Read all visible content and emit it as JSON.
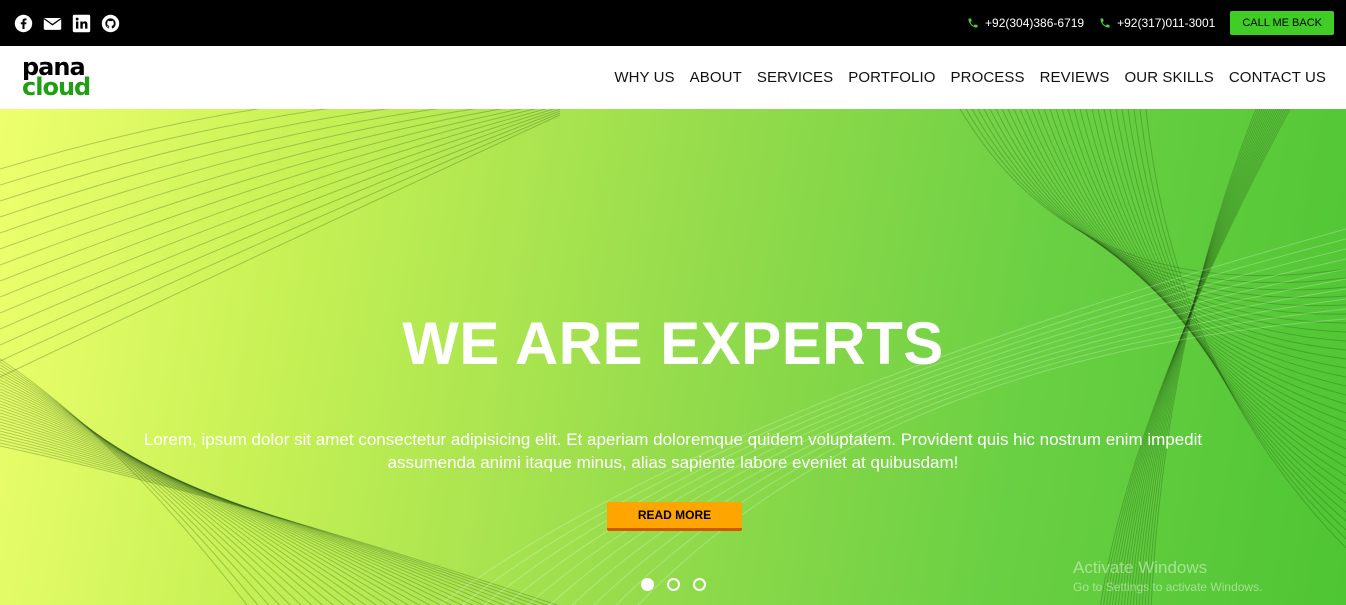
{
  "topbar": {
    "social": [
      {
        "icon": "facebook-icon"
      },
      {
        "icon": "email-icon"
      },
      {
        "icon": "linkedin-icon"
      },
      {
        "icon": "github-icon"
      }
    ],
    "phones": [
      "+92(304)386-6719",
      "+92(317)011-3001"
    ],
    "cta_label": "CALL ME BACK"
  },
  "navbar": {
    "logo_line1": "pana",
    "logo_line2": "cloud",
    "items": [
      "WHY US",
      "ABOUT",
      "SERVICES",
      "PORTFOLIO",
      "PROCESS",
      "REVIEWS",
      "OUR SKILLS",
      "CONTACT US"
    ]
  },
  "hero": {
    "title": "WE ARE EXPERTS",
    "text": "Lorem, ipsum dolor sit amet consectetur adipisicing elit. Et aperiam doloremque quidem voluptatem. Provident quis hic nostrum enim impedit assumenda animi itaque minus, alias sapiente labore eveniet at quibusdam!",
    "button_label": "READ MORE",
    "slide_count": 3,
    "active_slide": 1
  },
  "watermark": {
    "line1": "Activate Windows",
    "line2": "Go to Settings to activate Windows."
  },
  "colors": {
    "accent_green": "#3fcd26",
    "logo_green": "#1ea012",
    "button_orange": "#ffa500",
    "topbar_bg": "#000000"
  }
}
